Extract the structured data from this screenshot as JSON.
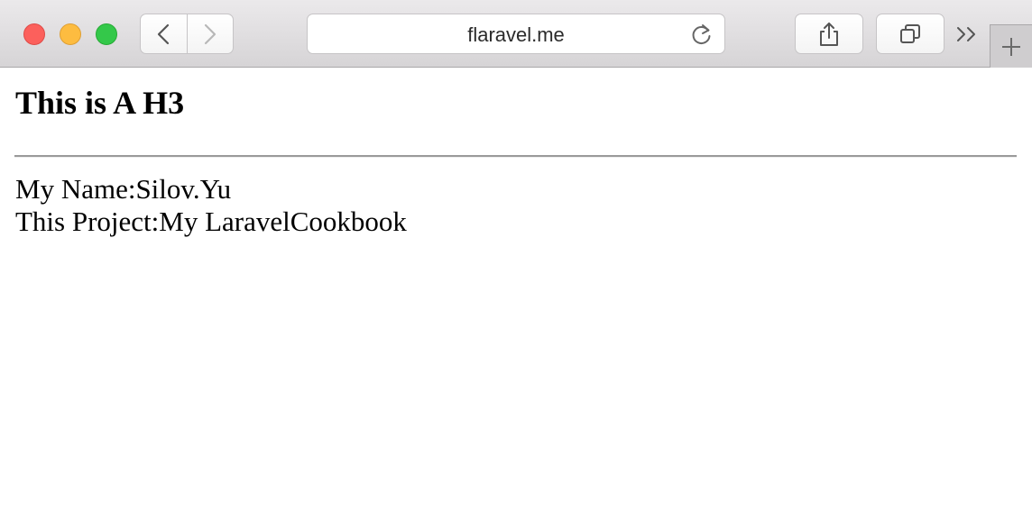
{
  "browser": {
    "url": "flaravel.me",
    "icons": {
      "back": "chevron-left-icon",
      "forward": "chevron-right-icon",
      "reload": "reload-icon",
      "share": "share-icon",
      "tabs": "tabs-overview-icon",
      "more": "double-chevron-right-icon",
      "new_tab": "plus-icon"
    },
    "colors": {
      "close": "#fc605c",
      "minimize": "#fdbc40",
      "zoom": "#34c84a"
    }
  },
  "page": {
    "heading": "This is A H3",
    "name_line": "My Name:Silov.Yu",
    "project_line": "This Project:My LaravelCookbook"
  }
}
